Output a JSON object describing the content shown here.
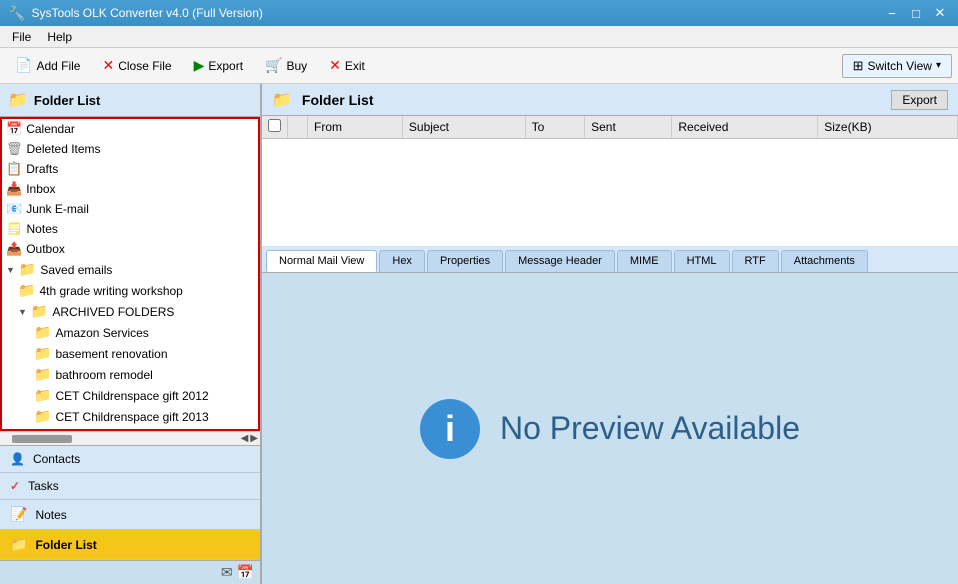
{
  "titleBar": {
    "title": "SysTools OLK Converter v4.0 (Full Version)",
    "icon": "⚙",
    "minimize": "−",
    "maximize": "□",
    "close": "✕"
  },
  "menuBar": {
    "items": [
      "File",
      "Help"
    ]
  },
  "toolbar": {
    "addFile": "Add File",
    "closeFile": "Close File",
    "export": "Export",
    "buy": "Buy",
    "exit": "Exit",
    "switchView": "Switch View"
  },
  "leftPanel": {
    "header": "Folder List",
    "tree": [
      {
        "label": "Calendar",
        "icon": "calendar",
        "indent": 0
      },
      {
        "label": "Deleted Items",
        "icon": "deleted",
        "indent": 0
      },
      {
        "label": "Drafts",
        "icon": "drafts",
        "indent": 0
      },
      {
        "label": "Inbox",
        "icon": "inbox",
        "indent": 0
      },
      {
        "label": "Junk E-mail",
        "icon": "junk",
        "indent": 0
      },
      {
        "label": "Notes",
        "icon": "notes",
        "indent": 0
      },
      {
        "label": "Outbox",
        "icon": "outbox",
        "indent": 0
      },
      {
        "label": "Saved emails",
        "icon": "folder",
        "indent": 0
      },
      {
        "label": "4th grade writing workshop",
        "icon": "folder",
        "indent": 1
      },
      {
        "label": "ARCHIVED FOLDERS",
        "icon": "folder",
        "indent": 1
      },
      {
        "label": "Amazon Services",
        "icon": "folder",
        "indent": 2
      },
      {
        "label": "basement renovation",
        "icon": "folder",
        "indent": 2
      },
      {
        "label": "bathroom remodel",
        "icon": "folder",
        "indent": 2
      },
      {
        "label": "CET Childrenspace gift 2012",
        "icon": "folder",
        "indent": 2
      },
      {
        "label": "CET Childrenspace gift 2013",
        "icon": "folder",
        "indent": 2
      }
    ]
  },
  "rightPanel": {
    "header": "Folder List",
    "exportLabel": "Export",
    "tableColumns": [
      "",
      "",
      "From",
      "Subject",
      "To",
      "Sent",
      "Received",
      "Size(KB)"
    ]
  },
  "previewTabs": [
    {
      "label": "Normal Mail View",
      "active": true
    },
    {
      "label": "Hex"
    },
    {
      "label": "Properties"
    },
    {
      "label": "Message Header"
    },
    {
      "label": "MIME"
    },
    {
      "label": "HTML"
    },
    {
      "label": "RTF"
    },
    {
      "label": "Attachments"
    }
  ],
  "preview": {
    "icon": "i",
    "text": "No Preview Available"
  },
  "bottomNav": [
    {
      "label": "Contacts",
      "icon": "👤"
    },
    {
      "label": "Tasks",
      "icon": "✓"
    },
    {
      "label": "Notes",
      "icon": "📝"
    },
    {
      "label": "Folder List",
      "icon": "📁",
      "active": true
    }
  ]
}
